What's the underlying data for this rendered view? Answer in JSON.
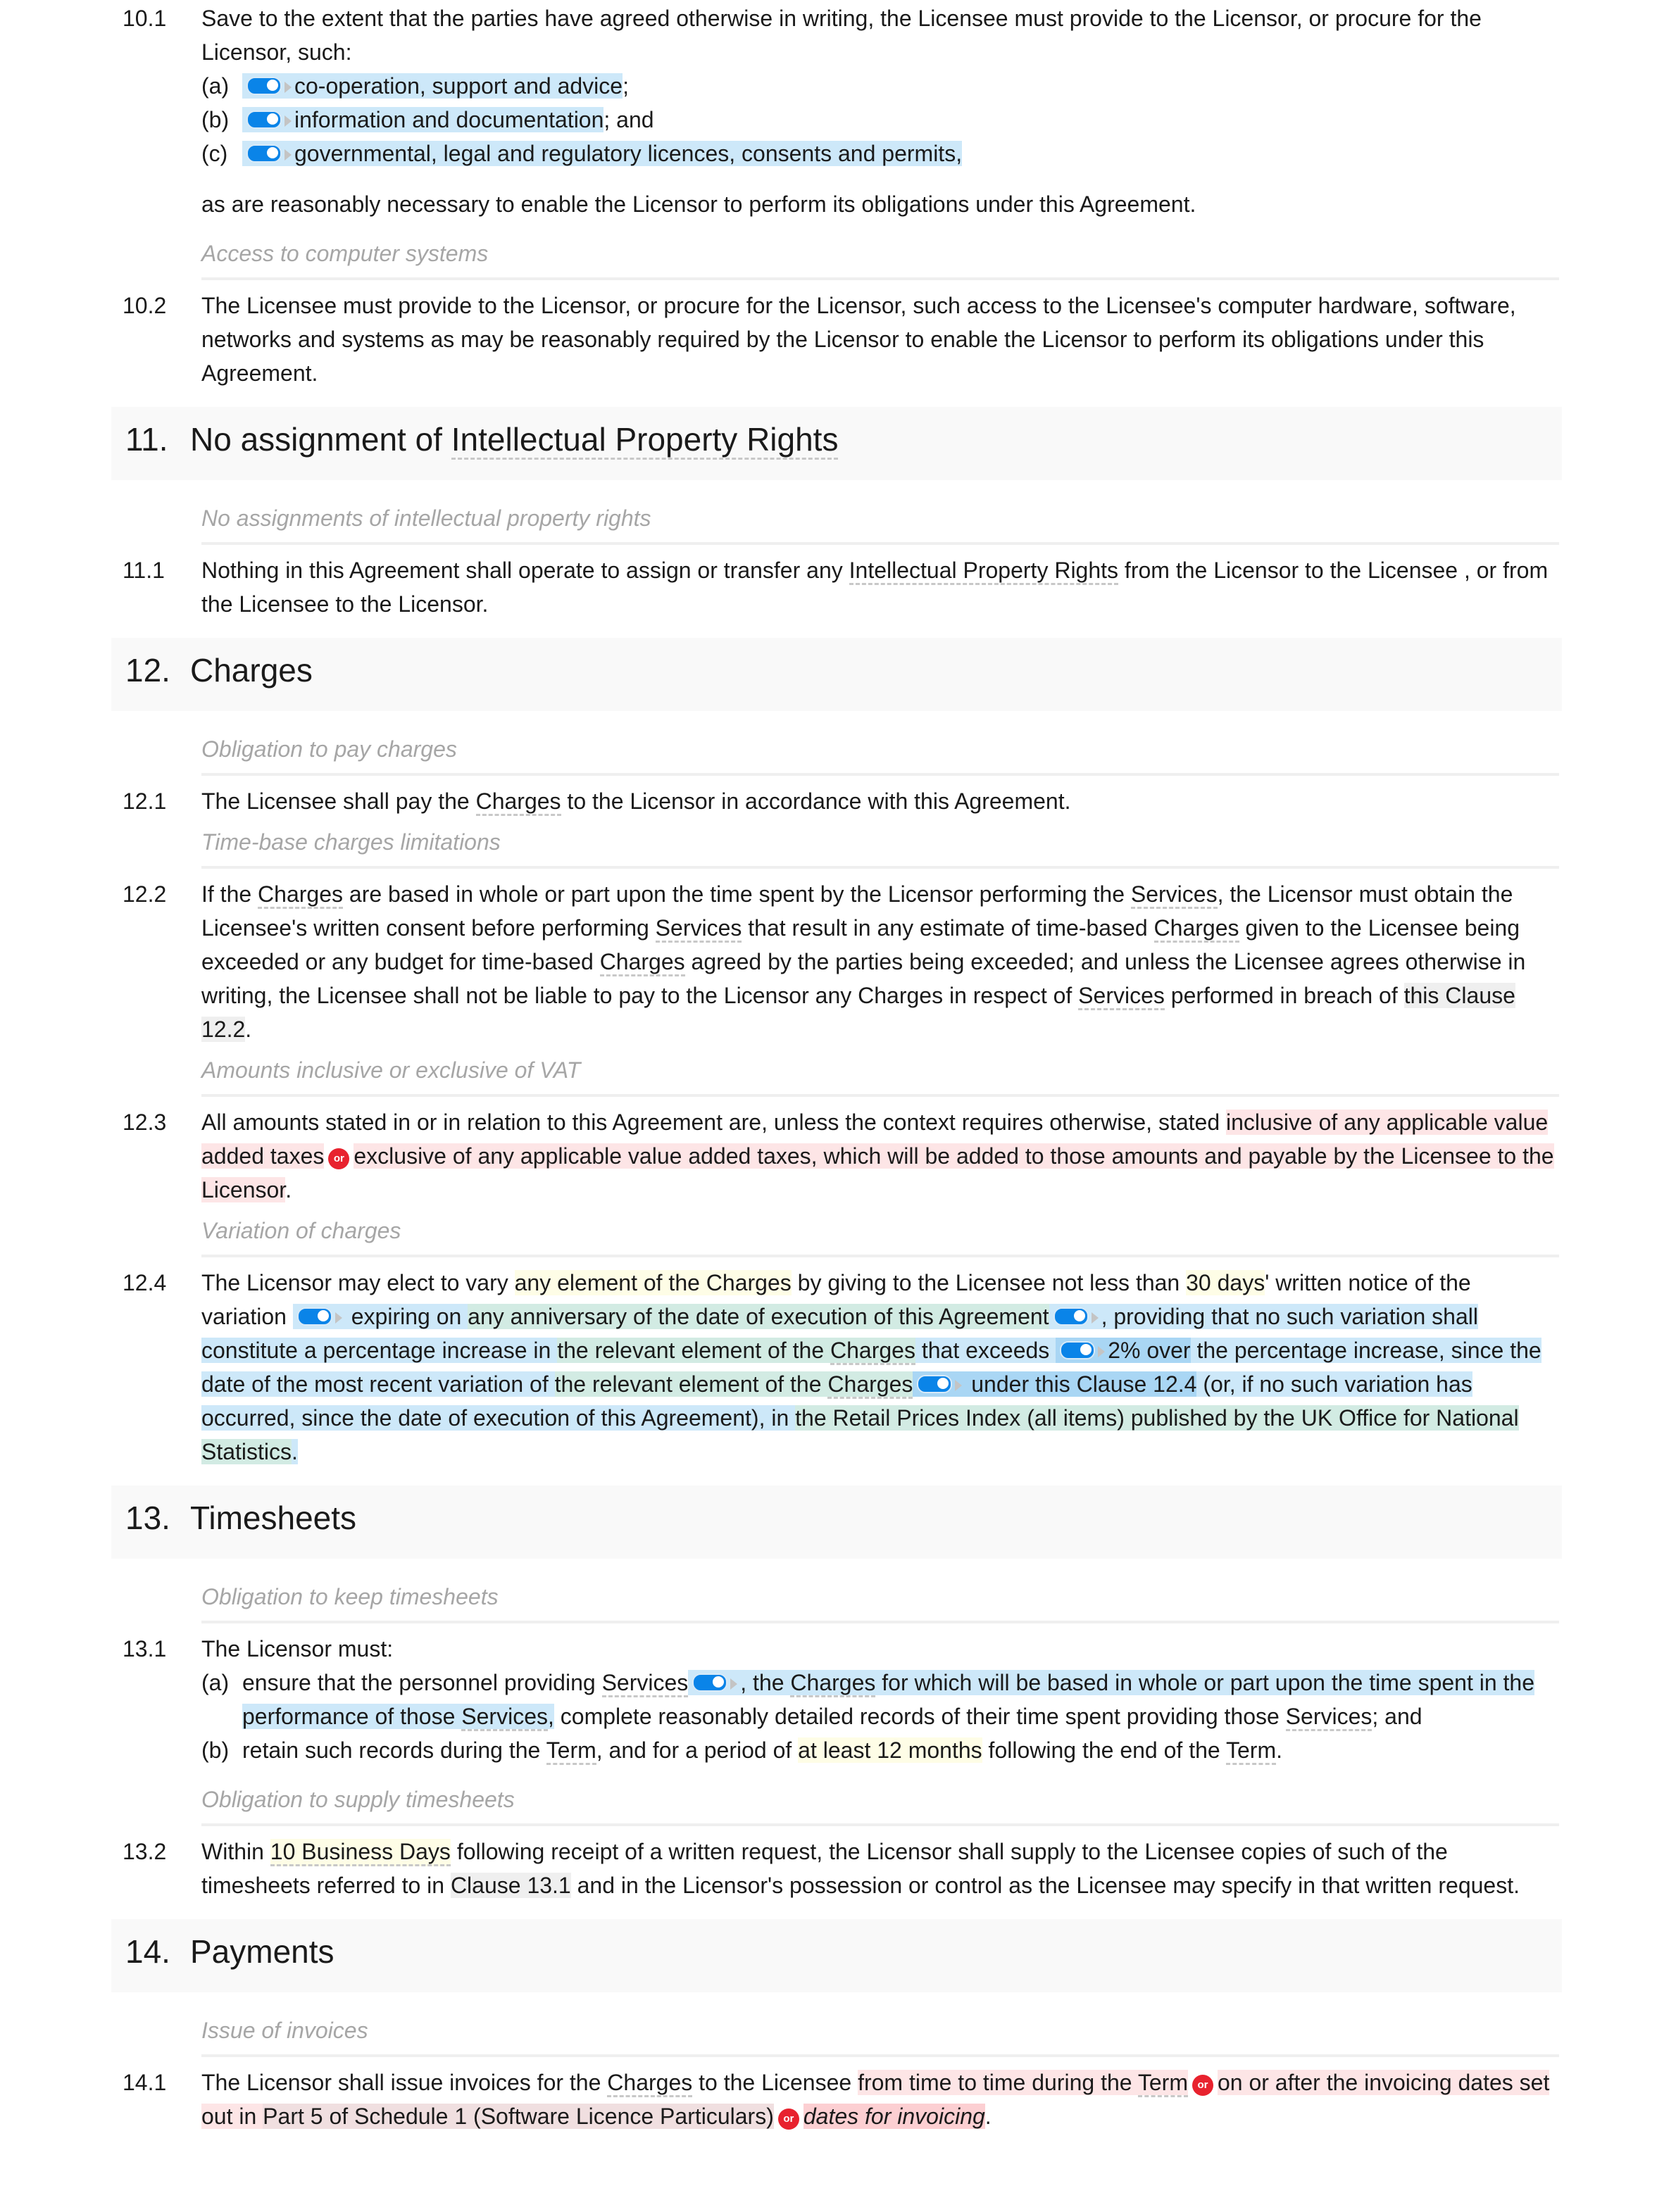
{
  "clause_10": {
    "c10_1": {
      "num": "10.1",
      "intro": "Save to the extent that the parties have agreed otherwise in writing, the Licensee must provide to the Licensor, or procure for the Licensor, such:",
      "items": [
        {
          "label": "(a)",
          "text": "co-operation, support and advice",
          "tail": ";"
        },
        {
          "label": "(b)",
          "text": "information and documentation",
          "tail": "; and"
        },
        {
          "label": "(c)",
          "text": "governmental, legal and regulatory licences, consents and permits",
          "tail": ","
        }
      ],
      "outro": "as are reasonably necessary to enable the Licensor to perform its obligations under this Agreement."
    },
    "sub_10_2": "Access to computer systems",
    "c10_2": {
      "num": "10.2",
      "text": "The Licensee must provide to the Licensor, or procure for the Licensor, such access to the Licensee's computer hardware, software, networks and systems as may be reasonably required by the Licensor to enable the Licensor to perform its obligations under this Agreement."
    }
  },
  "clause_11": {
    "num": "11.",
    "title_a": "No assignment of ",
    "title_def": "Intellectual Property Rights",
    "sub_11_1": "No assignments of intellectual property rights",
    "c11_1": {
      "num": "11.1",
      "a": "Nothing in this Agreement shall operate to assign or transfer any ",
      "def": "Intellectual Property Rights",
      "b": " from the Licensor to the Licensee , or from the Licensee to the Licensor."
    }
  },
  "clause_12": {
    "num": "12.",
    "title": "Charges",
    "sub_12_1": "Obligation to pay charges",
    "c12_1": {
      "num": "12.1",
      "a": "The Licensee shall pay the ",
      "def": "Charges",
      "b": " to the Licensor in accordance with this Agreement."
    },
    "sub_12_2": "Time-base charges limitations",
    "c12_2": {
      "num": "12.2",
      "p1": "If the ",
      "d1": "Charges",
      "p2": " are based in whole or part upon the time spent by the Licensor performing the ",
      "d2": "Services",
      "p3": ", the Licensor must obtain the Licensee's written consent before performing ",
      "d3": "Services",
      "p4": " that result in any estimate of time-based ",
      "d4": "Charges",
      "p5": " given to the Licensee being exceeded or any budget for time-based ",
      "d5": "Charges",
      "p6": " agreed by the parties being exceeded; and unless the Licensee agrees otherwise in writing, the Licensee shall not be liable to pay to the Licensor any Charges in respect of ",
      "d6": "Services",
      "p7": " performed in breach of ",
      "ref": "this Clause 12.2",
      "p8": "."
    },
    "sub_12_3": "Amounts inclusive or exclusive of VAT",
    "c12_3": {
      "num": "12.3",
      "a": "All amounts stated in or in relation to this Agreement are, unless the context requires otherwise, stated ",
      "opt1": "inclusive of any applicable value added taxes",
      "or": "or",
      "opt2": "exclusive of any applicable value added taxes, which will be added to those amounts and payable by the Licensee to the Licensor",
      "b": "."
    },
    "sub_12_4": "Variation of charges",
    "c12_4": {
      "num": "12.4",
      "a": "The Licensor may elect to vary ",
      "y1": "any element of the Charges",
      "b": " by giving to the Licensee not less than ",
      "y2": "30 days",
      "c": "' written notice of the variation ",
      "d": " expiring on ",
      "g1": "any anniversary of the date of execution of this Agreement",
      "e": ", providing that no such variation shall constitute a percentage increase in ",
      "g2a": "the relevant element of the ",
      "g2def": "Charges",
      "f": " that exceeds ",
      "pct": "2% over",
      "g": " the percentage increase, since the date of the most recent variation of ",
      "g3a": "the relevant element of the ",
      "g3def": "Charges",
      "h": " under this ",
      "ref": "Clause 12.4",
      "i": " (or, if no such variation has occurred, since the date of execution of this Agreement), in ",
      "g4": "the Retail Prices Index (all items) published by the UK Office for National Statistics",
      "j": "."
    }
  },
  "clause_13": {
    "num": "13.",
    "title": "Timesheets",
    "sub_13_1": "Obligation to keep timesheets",
    "c13_1": {
      "num": "13.1",
      "intro": "The Licensor must:",
      "a_label": "(a)",
      "a1": "ensure that the personnel providing ",
      "a_def1": "Services",
      "a_opt1": ", the ",
      "a_def2": "Charges",
      "a_opt2": " for which will be based in whole or part upon the time spent in the performance of those ",
      "a_def3": "Services",
      "a_opt3": ",",
      "a2": " complete reasonably detailed records of their time spent providing those ",
      "a_def4": "Services",
      "a3": "; and",
      "b_label": "(b)",
      "b1": "retain such records during the ",
      "b_def1": "Term",
      "b2": ", and for a period of ",
      "b_y": "at least 12 months",
      "b3": " following the end of the ",
      "b_def2": "Term",
      "b4": "."
    },
    "sub_13_2": "Obligation to supply timesheets",
    "c13_2": {
      "num": "13.2",
      "a": "Within ",
      "y": "10 Business Days",
      "b": " following receipt of a written request, the Licensor shall supply to the Licensee copies of such of the timesheets referred to in ",
      "ref": "Clause 13.1",
      "c": " and in the Licensor's possession or control as the Licensee may specify in that written request."
    }
  },
  "clause_14": {
    "num": "14.",
    "title": "Payments",
    "sub_14_1": "Issue of invoices",
    "c14_1": {
      "num": "14.1",
      "a": "The Licensor shall issue invoices for the ",
      "def": "Charges",
      "b": " to the Licensee ",
      "opt1a": "from time to time during the ",
      "opt1def": "Term",
      "or": "or",
      "opt2a": "on or after the invoicing dates set out in ",
      "opt2ref": "Part 5 of Schedule 1 (Software Licence Particulars)",
      "opt3": "dates for invoicing",
      "c": "."
    }
  }
}
